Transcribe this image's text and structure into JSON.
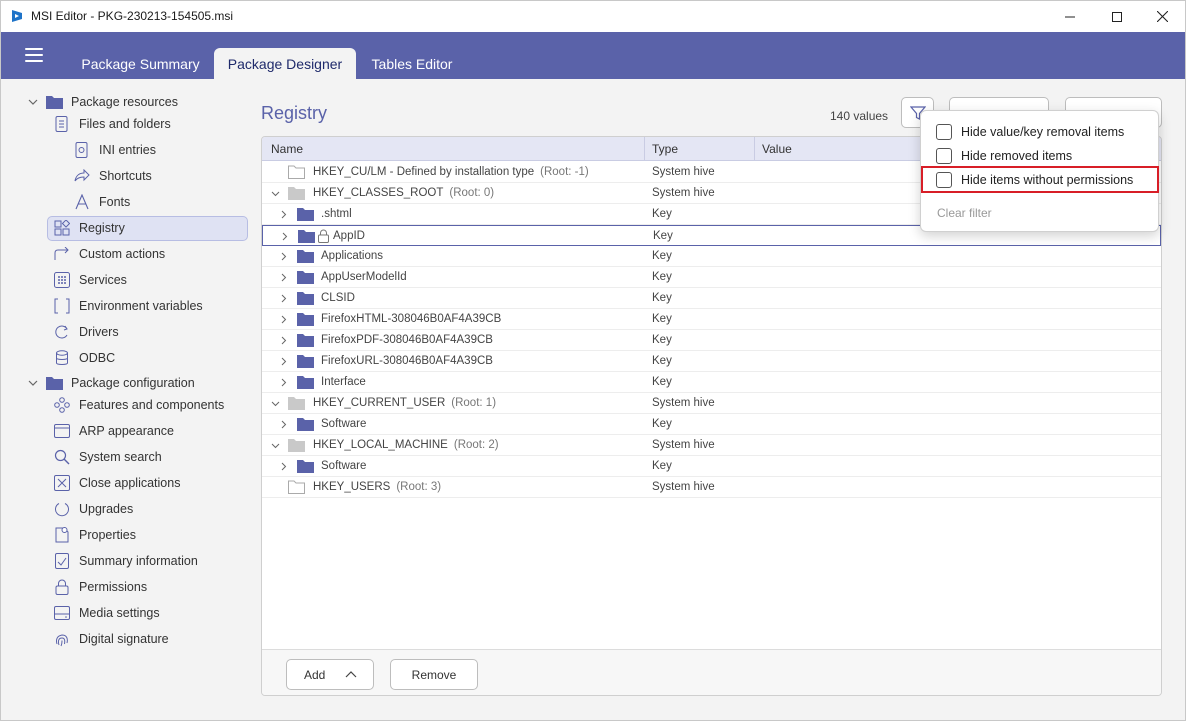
{
  "window": {
    "title": "MSI Editor - PKG-230213-154505.msi"
  },
  "tabs": [
    {
      "label": "Package Summary"
    },
    {
      "label": "Package Designer"
    },
    {
      "label": "Tables Editor"
    }
  ],
  "sidebar": {
    "groups": [
      {
        "label": "Package resources"
      },
      {
        "label": "Package configuration"
      }
    ],
    "items": [
      {
        "label": "Files and folders",
        "icon": "file-icon"
      },
      {
        "label": "INI entries",
        "icon": "ini-icon"
      },
      {
        "label": "Shortcuts",
        "icon": "shortcut-icon"
      },
      {
        "label": "Fonts",
        "icon": "font-icon"
      },
      {
        "label": "Registry",
        "icon": "registry-icon",
        "selected": true
      },
      {
        "label": "Custom actions",
        "icon": "custom-action-icon"
      },
      {
        "label": "Services",
        "icon": "services-icon"
      },
      {
        "label": "Environment variables",
        "icon": "env-icon"
      },
      {
        "label": "Drivers",
        "icon": "drivers-icon"
      },
      {
        "label": "ODBC",
        "icon": "database-icon"
      },
      {
        "label": "Features and components",
        "icon": "features-icon"
      },
      {
        "label": "ARP appearance",
        "icon": "window-icon"
      },
      {
        "label": "System search",
        "icon": "search-icon"
      },
      {
        "label": "Close applications",
        "icon": "close-app-icon"
      },
      {
        "label": "Upgrades",
        "icon": "upgrade-icon"
      },
      {
        "label": "Properties",
        "icon": "properties-icon"
      },
      {
        "label": "Summary information",
        "icon": "summary-icon"
      },
      {
        "label": "Permissions",
        "icon": "lock-icon"
      },
      {
        "label": "Media settings",
        "icon": "media-icon"
      },
      {
        "label": "Digital signature",
        "icon": "fingerprint-icon"
      }
    ]
  },
  "main": {
    "title": "Registry",
    "count": "140 values",
    "columns": [
      "Name",
      "Type",
      "Value"
    ],
    "rows": [
      {
        "name": "HKEY_CU/LM - Defined by installation type",
        "root": "(Root: -1)",
        "type": "System hive"
      },
      {
        "name": "HKEY_CLASSES_ROOT",
        "root": "(Root: 0)",
        "type": "System hive"
      },
      {
        "name": ".shtml",
        "root": "",
        "type": "Key"
      },
      {
        "name": "AppID",
        "root": "",
        "type": "Key"
      },
      {
        "name": "Applications",
        "root": "",
        "type": "Key"
      },
      {
        "name": "AppUserModelId",
        "root": "",
        "type": "Key"
      },
      {
        "name": "CLSID",
        "root": "",
        "type": "Key"
      },
      {
        "name": "FirefoxHTML-308046B0AF4A39CB",
        "root": "",
        "type": "Key"
      },
      {
        "name": "FirefoxPDF-308046B0AF4A39CB",
        "root": "",
        "type": "Key"
      },
      {
        "name": "FirefoxURL-308046B0AF4A39CB",
        "root": "",
        "type": "Key"
      },
      {
        "name": "Interface",
        "root": "",
        "type": "Key"
      },
      {
        "name": "HKEY_CURRENT_USER",
        "root": "(Root: 1)",
        "type": "System hive"
      },
      {
        "name": "Software",
        "root": "",
        "type": "Key"
      },
      {
        "name": "HKEY_LOCAL_MACHINE",
        "root": "(Root: 2)",
        "type": "System hive"
      },
      {
        "name": "Software",
        "root": "",
        "type": "Key"
      },
      {
        "name": "HKEY_USERS",
        "root": "(Root: 3)",
        "type": "System hive"
      }
    ],
    "add_label": "Add",
    "remove_label": "Remove"
  },
  "filter_popup": {
    "options": [
      {
        "label": "Hide value/key removal items",
        "checked": false
      },
      {
        "label": "Hide removed items",
        "checked": false
      },
      {
        "label": "Hide items without permissions",
        "checked": false
      }
    ],
    "clear_label": "Clear filter"
  },
  "colors": {
    "accent": "#5a62a9",
    "highlight": "#d81e27",
    "folder": "#5a62a9"
  }
}
